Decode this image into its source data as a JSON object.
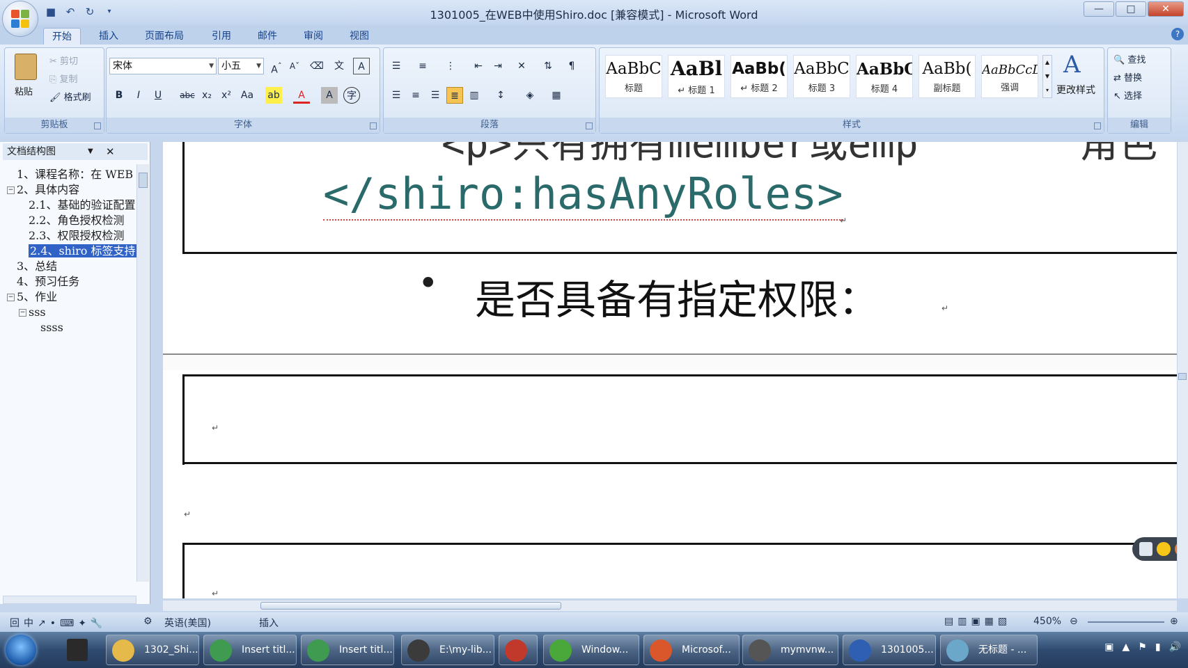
{
  "window": {
    "title": "1301005_在WEB中使用Shiro.doc [兼容模式] - Microsoft Word",
    "buttons": {
      "minimize": "—",
      "maximize": "□",
      "close": "✕"
    }
  },
  "quick_access": {
    "save_icon": "save-icon",
    "undo_icon": "undo-icon",
    "redo_icon": "redo-icon"
  },
  "tabs": [
    "开始",
    "插入",
    "页面布局",
    "引用",
    "邮件",
    "审阅",
    "视图"
  ],
  "ribbon": {
    "clipboard": {
      "paste": "粘贴",
      "cut": "剪切",
      "copy": "复制",
      "format_painter": "格式刷",
      "label": "剪贴板"
    },
    "font": {
      "font_name": "宋体",
      "font_size": "小五",
      "label": "字体"
    },
    "paragraph": {
      "label": "段落"
    },
    "styles": {
      "label": "样式",
      "items": [
        {
          "preview": "AaBbC",
          "name": "标题"
        },
        {
          "preview": "AaBl",
          "name": "↵ 标题 1"
        },
        {
          "preview": "AaBb(",
          "name": "↵ 标题 2"
        },
        {
          "preview": "AaBbC",
          "name": "标题 3"
        },
        {
          "preview": "AaBbC",
          "name": "标题 4"
        },
        {
          "preview": "AaBb(",
          "name": "副标题"
        },
        {
          "preview": "AaBbCcD",
          "name": "强调"
        }
      ],
      "change_styles": "更改样式"
    },
    "editing": {
      "find": "查找",
      "replace": "替换",
      "select": "选择",
      "label": "编辑"
    }
  },
  "nav_pane": {
    "title": "文档结构图",
    "items": [
      {
        "text": "1、课程名称：在 WEB",
        "level": 0
      },
      {
        "text": "2、具体内容",
        "level": 0,
        "toggle": "−"
      },
      {
        "text": "2.1、基础的验证配置",
        "level": 1
      },
      {
        "text": "2.2、角色授权检测",
        "level": 1
      },
      {
        "text": "2.3、权限授权检测",
        "level": 1
      },
      {
        "text": "2.4、shiro 标签支持",
        "level": 1,
        "selected": true
      },
      {
        "text": "3、总结",
        "level": 0
      },
      {
        "text": "4、预习任务",
        "level": 0
      },
      {
        "text": "5、作业",
        "level": 0,
        "toggle": "−"
      },
      {
        "text": "sss",
        "level": 1,
        "toggle": "−"
      },
      {
        "text": "ssss",
        "level": 2
      }
    ]
  },
  "document": {
    "top_partial": "<p>只有拥有member或emp",
    "top_partial_right": "角色",
    "code_line": "</shiro:hasAnyRoles>",
    "bullet": "•",
    "bullet_text": "是否具备有指定权限：",
    "para_mark": "↵"
  },
  "status_bar": {
    "language": "英语(美国)",
    "mode": "插入",
    "zoom": "450%"
  },
  "taskbar": {
    "items": [
      {
        "label": "1302_Shi...",
        "color": "#e5b94a"
      },
      {
        "label": "Insert titl...",
        "color": "#3e9b4f"
      },
      {
        "label": "Insert titl...",
        "color": "#3e9b4f"
      },
      {
        "label": "E:\\my-lib...",
        "color": "#3b3b3b"
      },
      {
        "label": "",
        "color": "#c0392b"
      },
      {
        "label": "Window...",
        "color": "#4aa83a"
      },
      {
        "label": "Microsof...",
        "color": "#d9572a"
      },
      {
        "label": "mymvnw...",
        "color": "#555"
      },
      {
        "label": "1301005...",
        "color": "#2f5fb3"
      },
      {
        "label": "无标题 - ...",
        "color": "#6aa7c8"
      }
    ]
  }
}
